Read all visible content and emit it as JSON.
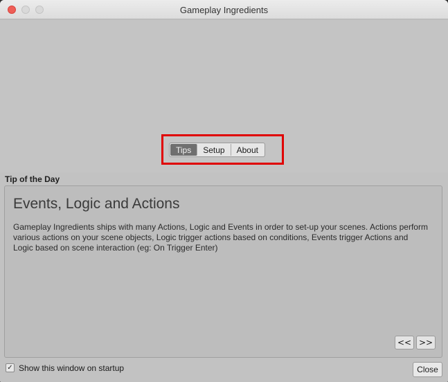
{
  "window": {
    "title": "Gameplay Ingredients"
  },
  "tabs": [
    {
      "label": "Tips",
      "active": true
    },
    {
      "label": "Setup",
      "active": false
    },
    {
      "label": "About",
      "active": false
    }
  ],
  "section": {
    "label": "Tip of the Day"
  },
  "tip": {
    "title": "Events, Logic and Actions",
    "body": "Gameplay Ingredients ships with many Actions, Logic and Events in order to set-up your scenes. Actions perform various actions on your scene objects, Logic trigger actions based on conditions, Events trigger Actions and Logic based on scene interaction (eg: On Trigger Enter)"
  },
  "navigation": {
    "prev_label": "<<",
    "next_label": ">>"
  },
  "footer": {
    "startup_label": "Show this window on startup",
    "startup_checked": true,
    "close_label": "Close"
  },
  "colors": {
    "highlight": "#e00000",
    "active_tab": "#6f6f6f"
  }
}
